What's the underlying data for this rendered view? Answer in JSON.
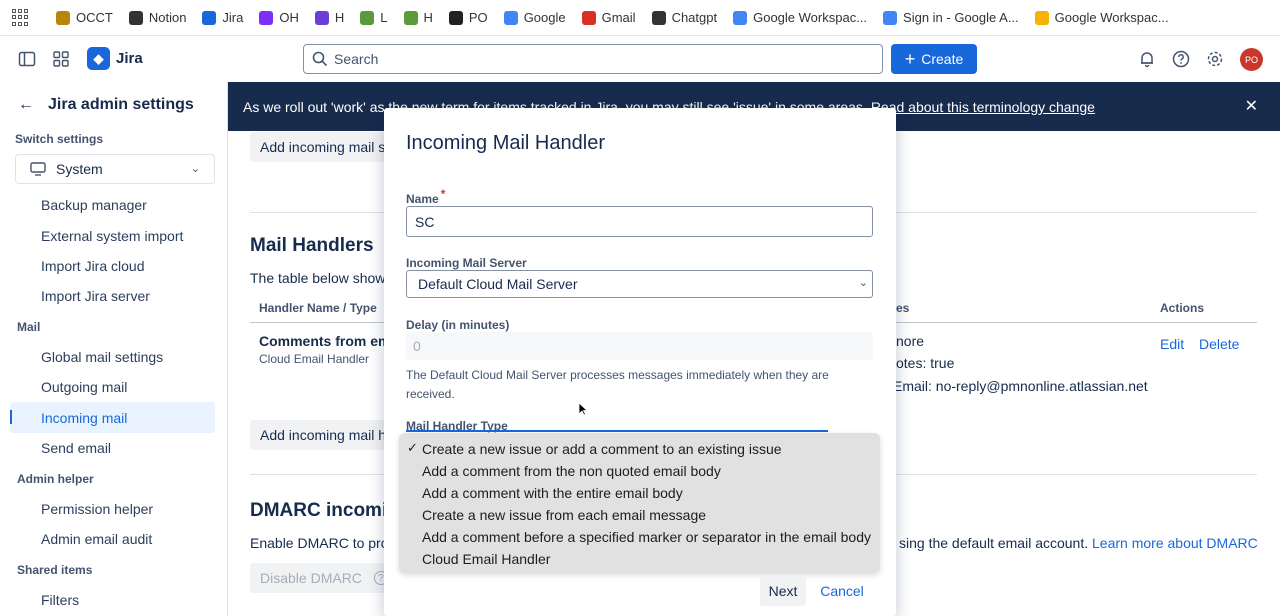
{
  "bookmarks": [
    {
      "label": "OCCT",
      "icon": "box-icon",
      "color": "#b8860b"
    },
    {
      "label": "Notion",
      "icon": "house-icon",
      "color": "#333333"
    },
    {
      "label": "Jira",
      "icon": "jira-icon",
      "color": "#1868db"
    },
    {
      "label": "OH",
      "icon": "oh-icon",
      "color": "#7b2ff7"
    },
    {
      "label": "H",
      "icon": "s-icon",
      "color": "#6a3fd8"
    },
    {
      "label": "L",
      "icon": "shopify-icon",
      "color": "#5a9a3a"
    },
    {
      "label": "H",
      "icon": "shopify-icon",
      "color": "#5a9a3a"
    },
    {
      "label": "PO",
      "icon": "github-icon",
      "color": "#222222"
    },
    {
      "label": "Google",
      "icon": "google-icon",
      "color": "#4285f4"
    },
    {
      "label": "Gmail",
      "icon": "gmail-icon",
      "color": "#d93025"
    },
    {
      "label": "Chatgpt",
      "icon": "chatgpt-icon",
      "color": "#333333"
    },
    {
      "label": "Google Workspac...",
      "icon": "google-icon",
      "color": "#4285f4"
    },
    {
      "label": "Sign in - Google A...",
      "icon": "google-icon",
      "color": "#4285f4"
    },
    {
      "label": "Google Workspac...",
      "icon": "workspace-icon",
      "color": "#f4b400"
    }
  ],
  "topnav": {
    "app_name": "Jira",
    "search_placeholder": "Search",
    "create_label": "Create",
    "avatar_initials": "PO"
  },
  "sidebar": {
    "title": "Jira admin settings",
    "switch_label": "Switch settings",
    "switch_value": "System",
    "items_top": [
      "Backup manager",
      "External system import",
      "Import Jira cloud",
      "Import Jira server"
    ],
    "mail_header": "Mail",
    "mail_items": [
      "Global mail settings",
      "Outgoing mail",
      "Incoming mail",
      "Send email"
    ],
    "admin_helper_header": "Admin helper",
    "admin_helper_items": [
      "Permission helper",
      "Admin email audit"
    ],
    "shared_header": "Shared items",
    "shared_items": [
      "Filters"
    ]
  },
  "banner": {
    "text": "As we roll out 'work' as the new term for items tracked in Jira, you may still see 'issue' in some areas.",
    "link": "Read about this terminology change"
  },
  "main": {
    "add_server_btn": "Add incoming mail s",
    "mail_handlers_title": "Mail Handlers",
    "mail_handlers_desc": "The table below show",
    "col_handler": "Handler Name / Type",
    "col_properties_partial": "es",
    "col_actions": "Actions",
    "row": {
      "name": "Comments from em",
      "type": "Cloud Email Handler",
      "prop1": "nore",
      "prop2": "otes: true",
      "prop3": "Email: no-reply@pmnonline.atlassian.net",
      "edit": "Edit",
      "delete": "Delete"
    },
    "add_handler_btn": "Add incoming mail h",
    "dmarc_title": "DMARC incomi",
    "dmarc_desc_left": "Enable DMARC to pro",
    "dmarc_desc_right": "sing the default email account.",
    "dmarc_link": "Learn more about DMARC",
    "disable_dmarc": "Disable DMARC"
  },
  "modal": {
    "title": "Incoming Mail Handler",
    "name_label": "Name",
    "name_value": "SC",
    "server_label": "Incoming Mail Server",
    "server_value": "Default Cloud Mail Server",
    "delay_label": "Delay (in minutes)",
    "delay_placeholder": "0",
    "help_text": "The Default Cloud Mail Server processes messages immediately when they are received.",
    "type_label": "Mail Handler Type",
    "type_options": [
      "Create a new issue or add a comment to an existing issue",
      "Add a comment from the non quoted email body",
      "Add a comment with the entire email body",
      "Create a new issue from each email message",
      "Add a comment before a specified marker or separator in the email body",
      "Cloud Email Handler"
    ],
    "type_selected_index": 0,
    "next_label": "Next",
    "cancel_label": "Cancel"
  }
}
